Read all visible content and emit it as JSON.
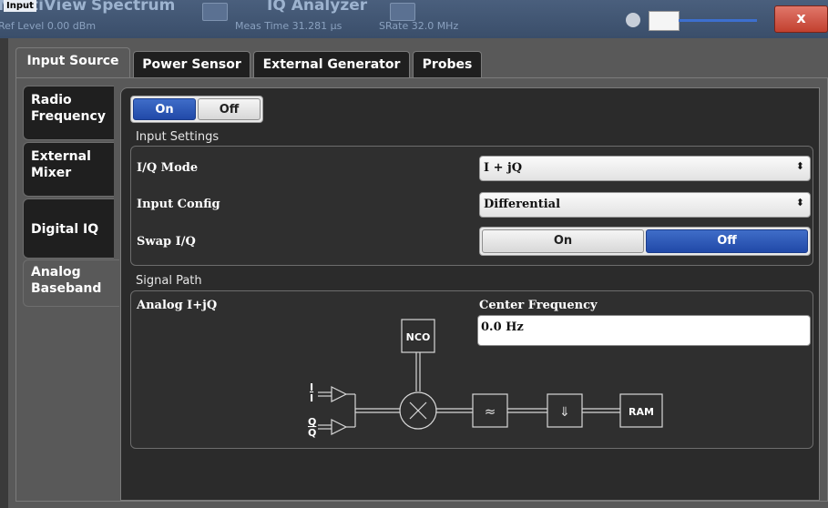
{
  "background_app": {
    "title": "MultiView",
    "tab1": "Spectrum",
    "tab2": "IQ Analyzer",
    "ref_level": "Ref Level  0.00 dBm",
    "meas_time": "Meas Time  31.281 µs",
    "srate": "SRate  32.0 MHz"
  },
  "dialog": {
    "title": "Input",
    "close_label": "x"
  },
  "top_tabs": [
    "Input Source",
    "Power Sensor",
    "External Generator",
    "Probes"
  ],
  "side_tabs": {
    "radio_frequency": "Radio Frequency",
    "external_mixer": "External Mixer",
    "digital_iq": "Digital IQ",
    "analog_baseband": "Analog Baseband"
  },
  "state_toggle": {
    "on": "On",
    "off": "Off",
    "selected": "On"
  },
  "input_settings": {
    "title": "Input Settings",
    "iq_mode_label": "I/Q Mode",
    "iq_mode_value": "I + jQ",
    "input_config_label": "Input Config",
    "input_config_value": "Differential",
    "swap_iq_label": "Swap I/Q",
    "swap_on": "On",
    "swap_off": "Off",
    "swap_selected": "Off"
  },
  "signal_path": {
    "title": "Signal Path",
    "path_label": "Analog I+jQ",
    "center_freq_label": "Center Frequency",
    "center_freq_value": "0.0 Hz",
    "nco_label": "NCO",
    "ram_label": "RAM",
    "filter_symbol": "≈",
    "decimate_symbol": "⇓",
    "i_label": "I",
    "i_bar_label": "I",
    "q_label": "Q",
    "q_bar_label": "Q"
  }
}
